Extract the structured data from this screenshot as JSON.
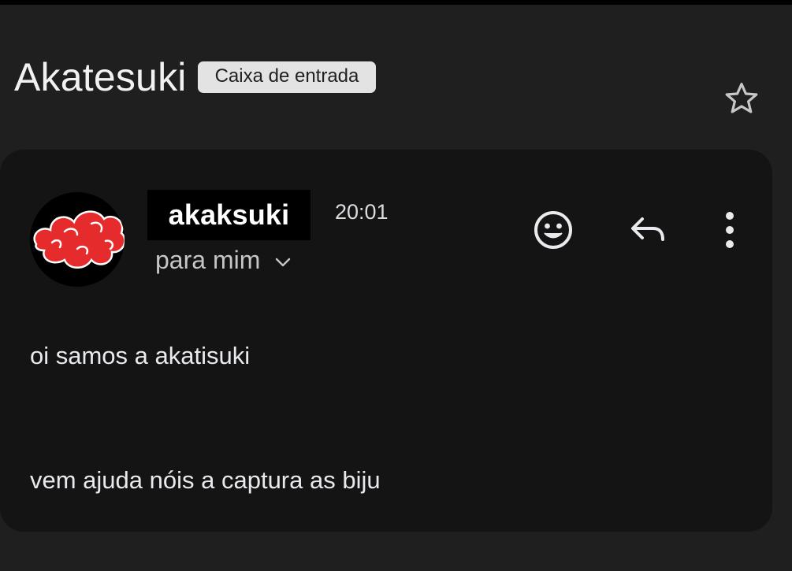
{
  "email": {
    "subject": "Akatesuki",
    "label": "Caixa de entrada"
  },
  "sender": {
    "name": "akaksuki",
    "time": "20:01",
    "recipient": "para mim"
  },
  "body": {
    "lines": [
      "oi samos a akatisuki",
      "vem ajuda nóis a captura as biju"
    ]
  },
  "icons": {
    "star": "star-outline-icon",
    "chevron": "chevron-down-icon",
    "emoji": "emoji-reaction-icon",
    "reply": "reply-icon",
    "more": "more-vertical-icon",
    "avatar": "red-cloud-icon"
  },
  "colors": {
    "background": "#1f1f1f",
    "card": "#141414",
    "chip": "#e3e3e3",
    "avatar_cloud": "#e52b2b"
  }
}
